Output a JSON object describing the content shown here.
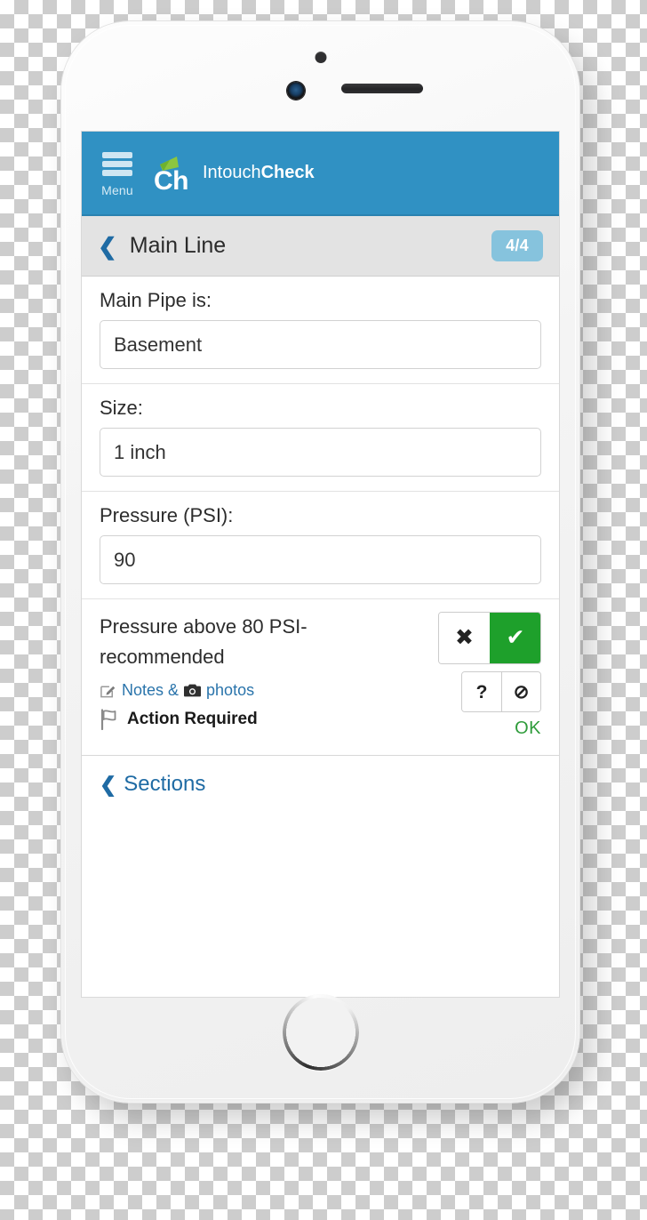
{
  "colors": {
    "header_blue": "#3091c3",
    "badge_blue": "#86c3dd",
    "pass_green": "#1ea02b",
    "ok_green": "#2f9c3b",
    "link_blue": "#1f6ba4",
    "logo_green": "#8cc63f"
  },
  "header": {
    "menu_label": "Menu",
    "menu_icon": "hamburger-menu-icon",
    "logo_icon": "intouchcheck-logo-icon",
    "logo_mark_text": "Ch",
    "brand_name_regular": "Intouch",
    "brand_name_bold": "Check"
  },
  "subnav": {
    "back_icon": "chevron-left-icon",
    "title": "Main Line",
    "badge": "4/4"
  },
  "fields": [
    {
      "label": "Main Pipe is:",
      "value": "Basement",
      "placeholder": "Main Pipe is"
    },
    {
      "label": "Size:",
      "value": "1 inch",
      "placeholder": "Size"
    },
    {
      "label": "Pressure (PSI):",
      "value": "90",
      "placeholder": "Pressure"
    }
  ],
  "question": {
    "text": "Pressure above 80 PSI- recommended",
    "notes_icon": "pencil-edit-icon",
    "notes_label": "Notes &",
    "photos_icon": "camera-icon",
    "photos_label": "photos",
    "flag_icon": "flag-icon",
    "action_label": "Action Required",
    "status_label": "OK",
    "buttons": {
      "fail": {
        "icon": "close-x-icon",
        "glyph": "✖",
        "selected": false
      },
      "pass": {
        "icon": "check-mark-icon",
        "glyph": "✔",
        "selected": true
      },
      "unknown": {
        "icon": "question-mark-icon",
        "glyph": "?",
        "selected": false
      },
      "not_applicable": {
        "icon": "no-entry-icon",
        "glyph": "⊘",
        "selected": false
      }
    }
  },
  "footer": {
    "back_icon": "chevron-left-icon",
    "sections_label": "Sections"
  },
  "device": {
    "sensor_icon": "proximity-sensor-icon",
    "camera_icon": "front-camera-icon",
    "earpiece_icon": "earpiece-speaker-icon",
    "home_button_icon": "home-button-icon"
  }
}
